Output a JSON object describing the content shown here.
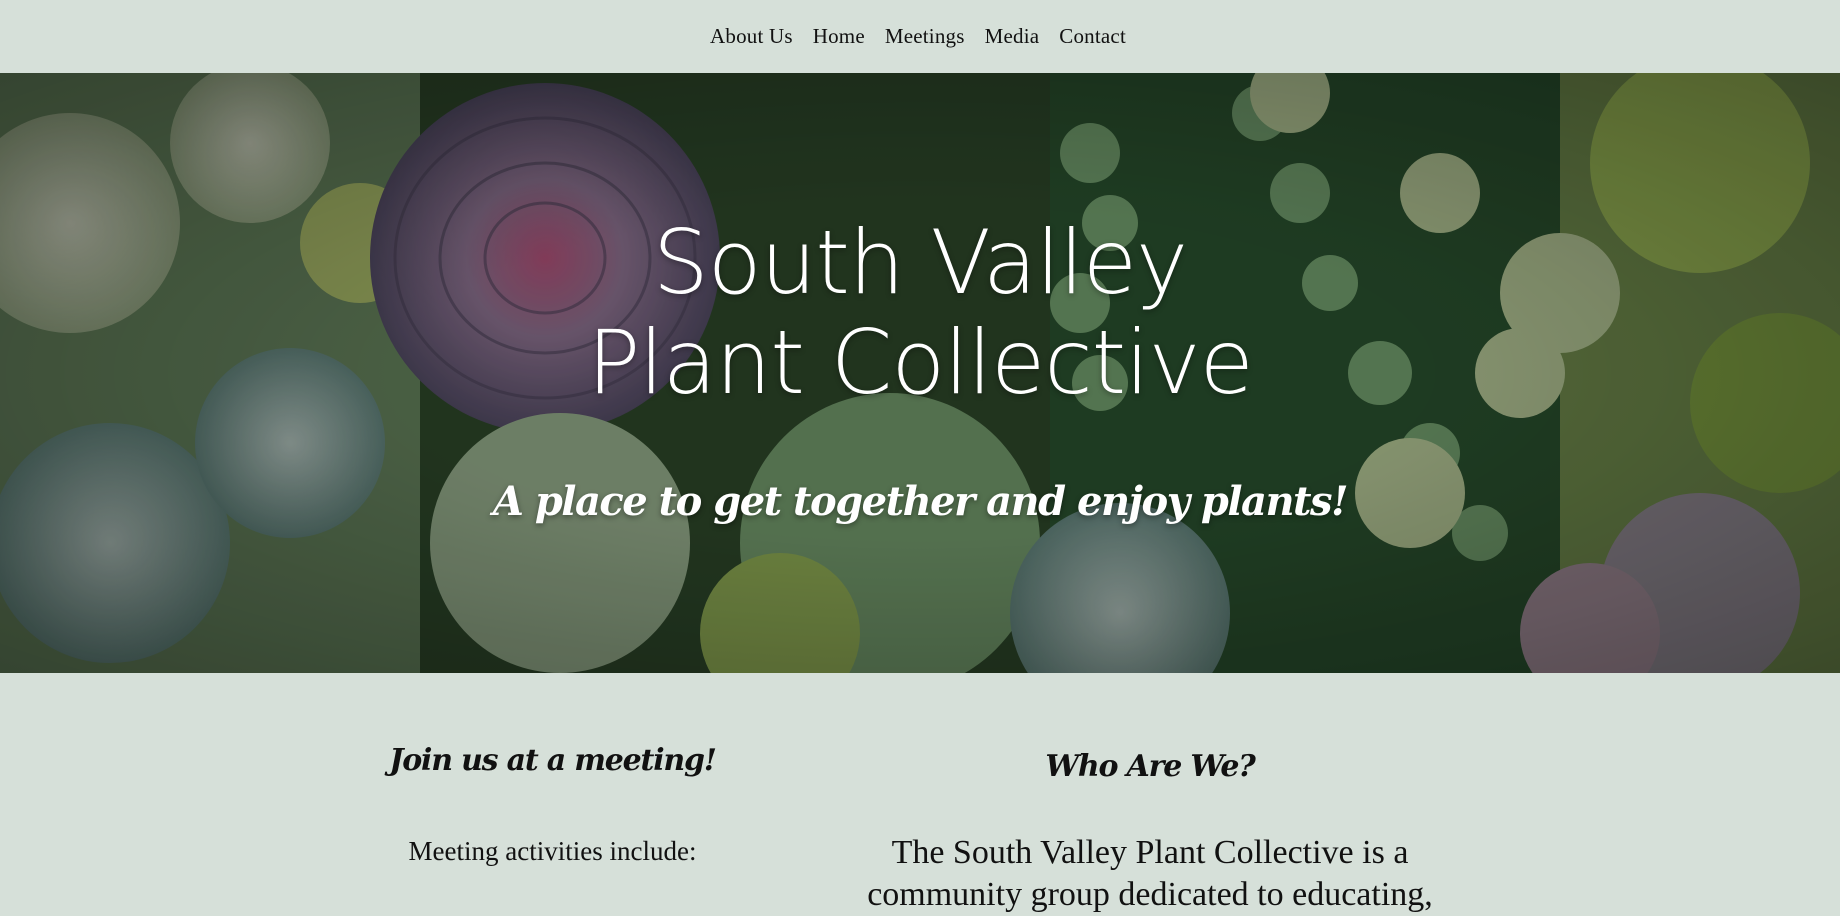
{
  "nav": {
    "items": [
      {
        "label": "About Us"
      },
      {
        "label": "Home"
      },
      {
        "label": "Meetings"
      },
      {
        "label": "Media"
      },
      {
        "label": "Contact"
      }
    ]
  },
  "hero": {
    "title_line1": "South Valley",
    "title_line2": "Plant Collective",
    "tagline": "A place to get together and enjoy plants!",
    "image": "succulent-garden-photo"
  },
  "meetings": {
    "heading": "Join us at a meeting!",
    "intro": "Meeting activities include:"
  },
  "about": {
    "heading": "Who Are We?",
    "text_line1": "The South Valley Plant Collective is a",
    "text_line2": "community group dedicated to educating,"
  },
  "colors": {
    "background": "#d6e0d9",
    "hero_text": "#ffffff",
    "body_text": "#111111"
  }
}
